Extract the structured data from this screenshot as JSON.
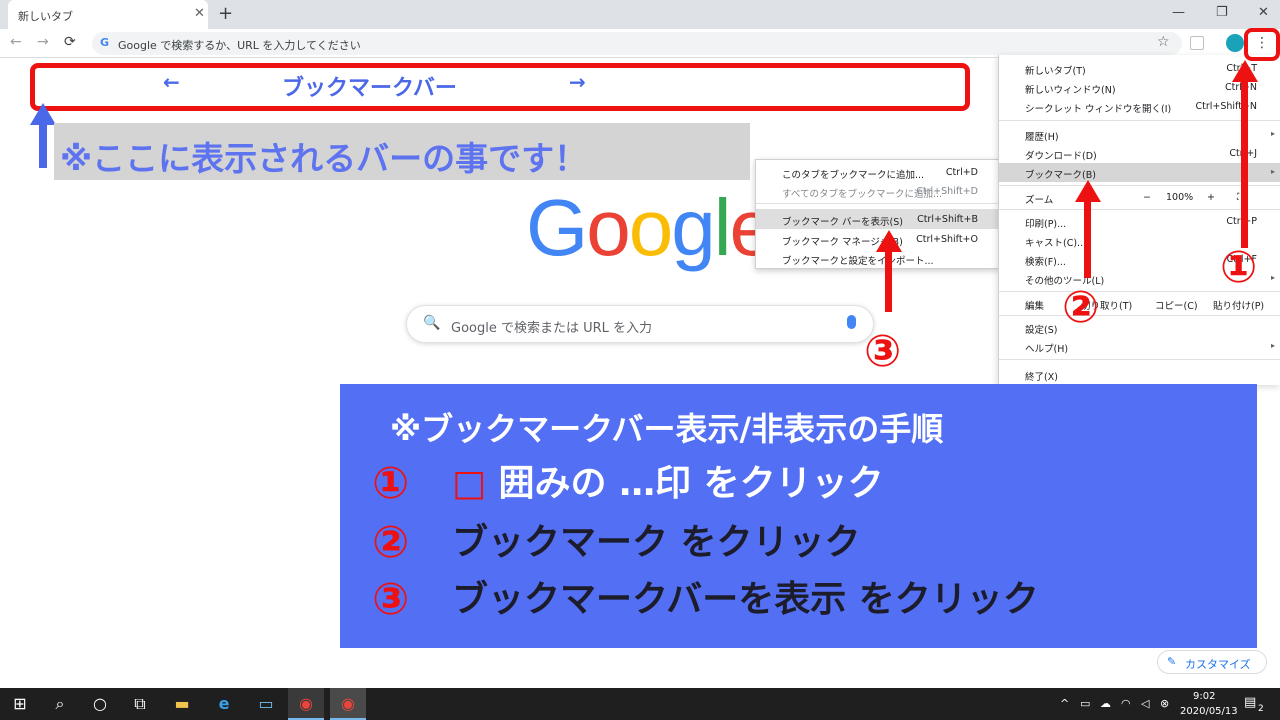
{
  "browser": {
    "tab_title": "新しいタブ",
    "tab_close": "✕",
    "new_tab": "+",
    "win_min": "—",
    "win_max": "❐",
    "win_close": "✕",
    "back": "←",
    "forward": "→",
    "reload": "⟳",
    "omnibox_g": "G",
    "omnibox_placeholder": "Google で検索するか、URL を入力してください",
    "star": "☆",
    "menu_dots": "⋮"
  },
  "annotations": {
    "bookmark_bar_arrow_left": "←",
    "bookmark_bar_label": "ブックマークバー",
    "bookmark_bar_arrow_right": "→",
    "note": "※ここに表示されるバーの事です！",
    "num1": "①",
    "num2": "②",
    "num3": "③"
  },
  "google": {
    "logo_letters": [
      "G",
      "o",
      "o",
      "g",
      "l",
      "e"
    ],
    "logo_colors": [
      "#4285f4",
      "#ea4335",
      "#fbbc05",
      "#4285f4",
      "#34a853",
      "#ea4335"
    ],
    "search_icon": "🔍",
    "search_placeholder": "Google で検索または URL を入力"
  },
  "bookmark_submenu": {
    "items": [
      {
        "label": "このタブをブックマークに追加...",
        "shortcut": "Ctrl+D"
      },
      {
        "label": "すべてのタブをブックマークに追加...",
        "shortcut": "Ctrl+Shift+D"
      },
      {
        "label": "ブックマーク バーを表示(S)",
        "shortcut": "Ctrl+Shift+B"
      },
      {
        "label": "ブックマーク マネージャ(B)",
        "shortcut": "Ctrl+Shift+O"
      },
      {
        "label": "ブックマークと設定をインポート...",
        "shortcut": ""
      }
    ]
  },
  "main_menu": {
    "new_tab": {
      "label": "新しいタブ(T)",
      "shortcut": "Ctrl+T"
    },
    "new_window": {
      "label": "新しいウィンドウ(N)",
      "shortcut": "Ctrl+N"
    },
    "incognito": {
      "label": "シークレット ウィンドウを開く(I)",
      "shortcut": "Ctrl+Shift+N"
    },
    "history": {
      "label": "履歴(H)"
    },
    "downloads": {
      "label": "ダウンロード(D)",
      "shortcut": "Ctrl+J"
    },
    "bookmarks": {
      "label": "ブックマーク(B)"
    },
    "zoom": {
      "label": "ズーム",
      "minus": "−",
      "value": "100%",
      "plus": "+",
      "fullscreen": "⛶"
    },
    "print": {
      "label": "印刷(P)...",
      "shortcut": "Ctrl+P"
    },
    "cast": {
      "label": "キャスト(C)..."
    },
    "find": {
      "label": "検索(F)...",
      "shortcut": "Ctrl+F"
    },
    "more_tools": {
      "label": "その他のツール(L)"
    },
    "edit": {
      "label": "編集",
      "cut": "切り取り(T)",
      "copy": "コピー(C)",
      "paste": "貼り付け(P)"
    },
    "settings": {
      "label": "設定(S)"
    },
    "help": {
      "label": "ヘルプ(H)"
    },
    "exit": {
      "label": "終了(X)"
    },
    "submenu_arrow": "▸"
  },
  "panel": {
    "title": "※ブックマークバー表示/非表示の手順",
    "steps": [
      {
        "num": "①",
        "box": "□",
        "text": " 囲みの …印 をクリック"
      },
      {
        "num": "②",
        "text": "ブックマーク をクリック"
      },
      {
        "num": "③",
        "text": "ブックマークバーを表示 をクリック"
      }
    ]
  },
  "customize": {
    "icon": "✎",
    "label": "カスタマイズ"
  },
  "taskbar": {
    "start": "⊞",
    "search": "⌕",
    "cortana": "○",
    "task_view": "⧉",
    "explorer": "▬",
    "edge": "e",
    "app": "▭",
    "chrome1": "◉",
    "chrome2": "◉",
    "tray_chevron": "^",
    "tray_battery": "▭",
    "tray_cloud": "☁",
    "tray_wifi": "◠",
    "tray_volume": "◁",
    "tray_x": "⊗",
    "time": "9:02",
    "date": "2020/05/13",
    "notification": "▤",
    "notification_count": "2"
  }
}
